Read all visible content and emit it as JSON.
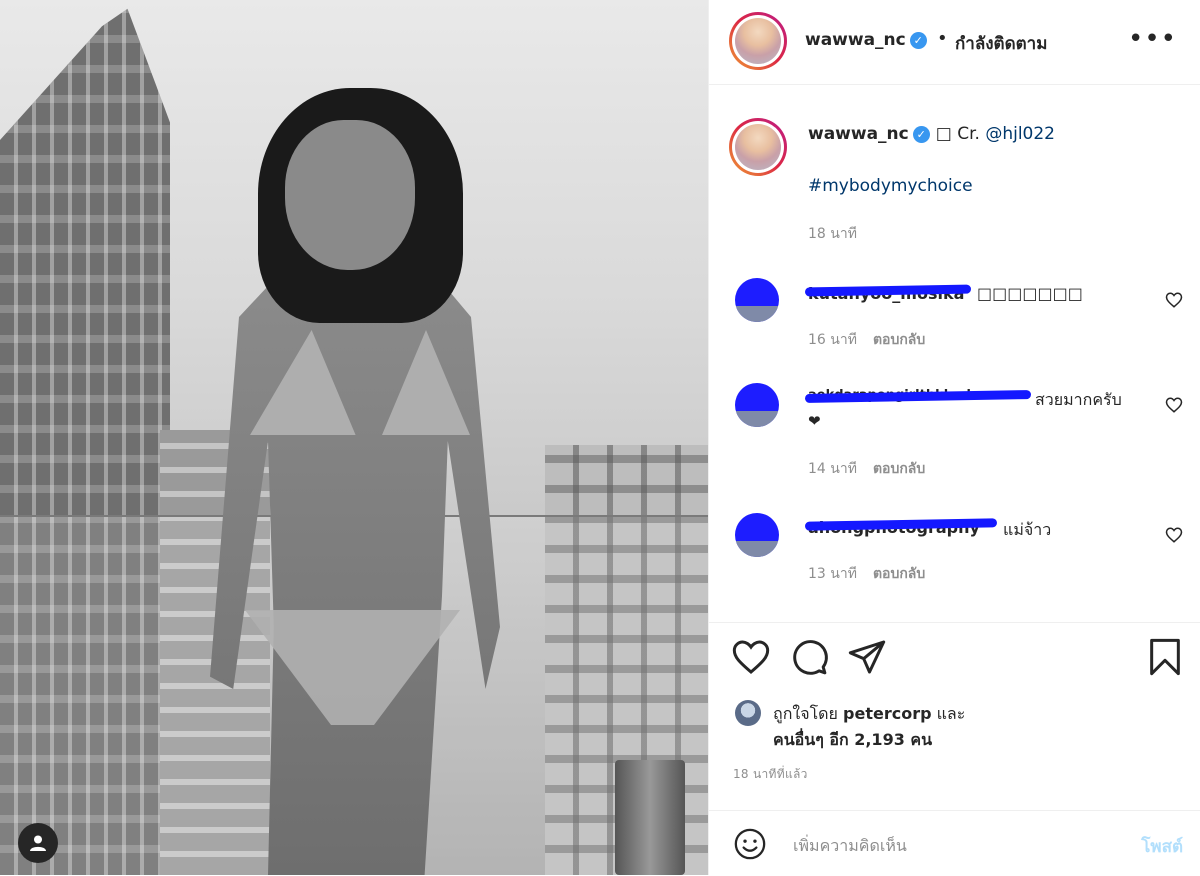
{
  "post": {
    "username": "wawwa_nc",
    "verified_mark": "✓",
    "dot": "•",
    "follow_status": "กำลังติดตาม",
    "more": "•••"
  },
  "caption": {
    "username": "wawwa_nc",
    "text_prefix": "□ Cr. ",
    "mention": "@hjl022",
    "hashtag": "#mybodymychoice",
    "time": "18 นาที"
  },
  "comments": [
    {
      "username_visible": "kutanyoo_mosika",
      "text": "□□□□□□□",
      "time": "16 นาที",
      "reply": "ตอบกลับ"
    },
    {
      "username_visible": "aekdarapongirlthkkud",
      "text": "สวยมากครับ",
      "text_line2": "❤",
      "time": "14 นาที",
      "reply": "ตอบกลับ"
    },
    {
      "username_visible": "ahongphotography",
      "text": "แม่จ้าว",
      "time": "13 นาที",
      "reply": "ตอบกลับ"
    }
  ],
  "likes": {
    "prefix": "ถูกใจโดย ",
    "user": "petercorp",
    "middle": " และ",
    "others": "คนอื่นๆ อีก 2,193 คน"
  },
  "post_time": "18 นาทีที่แล้ว",
  "comment_box": {
    "placeholder": "เพิ่มความคิดเห็น",
    "post_label": "โพสต์"
  },
  "icons": {
    "like": "heart-icon",
    "comment": "comment-icon",
    "share": "share-icon",
    "save": "bookmark-icon",
    "emoji": "emoji-icon",
    "more": "more-icon",
    "profile": "user-icon"
  },
  "colors": {
    "link": "#00376b",
    "verified": "#3897f0",
    "muted": "#8e8e8e",
    "post_button_disabled": "#b2dffc",
    "scribble": "#1418ff"
  }
}
